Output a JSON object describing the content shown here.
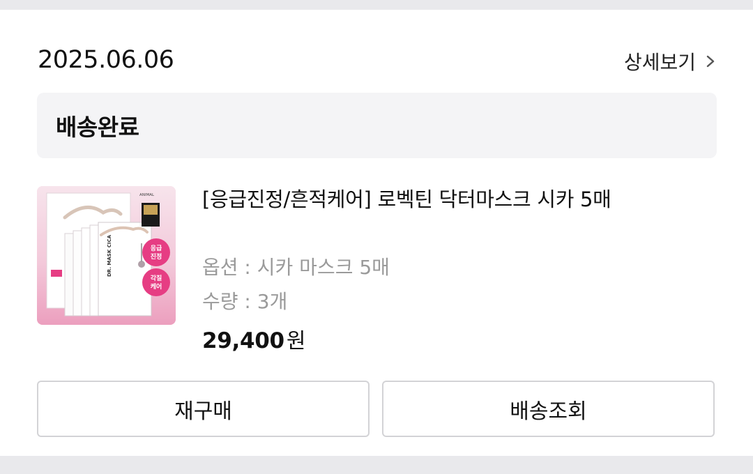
{
  "order": {
    "date": "2025.06.06",
    "detail_link_label": "상세보기",
    "status": "배송완료"
  },
  "product": {
    "name": "[응급진정/흔적케어] 로벡틴 닥터마스크 시카 5매",
    "option": "옵션 : 시카 마스크 5매",
    "quantity": "수량 : 3개",
    "price_amount": "29,400",
    "price_unit": "원",
    "thumbnail": {
      "badge_top": "응급진정",
      "badge_bottom": "각질케어",
      "package_brand": "DR. MASK CICA",
      "award_text": "ANIMAL TEST-FREE VEGAN"
    }
  },
  "actions": {
    "rebuy_label": "재구매",
    "track_label": "배송조회"
  },
  "colors": {
    "background": "#e9e9ec",
    "card": "#ffffff",
    "status_box": "#f4f4f6",
    "muted_text": "#9a9a9a",
    "button_border": "#d3d3d6",
    "thumb_pink": "#e63d83"
  },
  "icons": {
    "detail_chevron": "chevron-right-icon"
  }
}
